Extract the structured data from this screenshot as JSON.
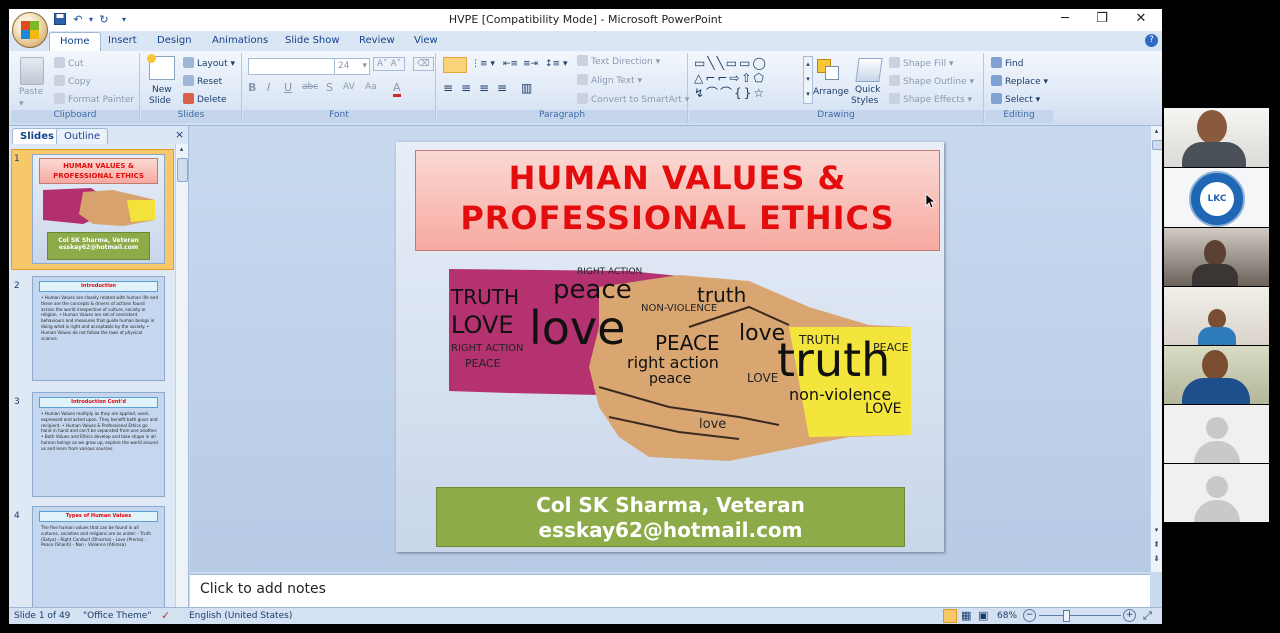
{
  "window": {
    "title": "HVPE [Compatibility Mode] - Microsoft PowerPoint",
    "minimize": "─",
    "restore": "❐",
    "close": "✕"
  },
  "ribbon_tabs": [
    "Home",
    "Insert",
    "Design",
    "Animations",
    "Slide Show",
    "Review",
    "View"
  ],
  "ribbon": {
    "clipboard": {
      "paste": "Paste",
      "cut": "Cut",
      "copy": "Copy",
      "format_painter": "Format Painter",
      "label": "Clipboard"
    },
    "slides": {
      "new_slide_1": "New",
      "new_slide_2": "Slide",
      "layout": "Layout",
      "reset": "Reset",
      "delete": "Delete",
      "label": "Slides"
    },
    "font": {
      "size": "24",
      "label": "Font"
    },
    "paragraph": {
      "text_direction": "Text Direction",
      "align_text": "Align Text",
      "convert": "Convert to SmartArt",
      "label": "Paragraph"
    },
    "drawing": {
      "arrange": "Arrange",
      "quick_styles_1": "Quick",
      "quick_styles_2": "Styles",
      "shape_fill": "Shape Fill",
      "shape_outline": "Shape Outline",
      "shape_effects": "Shape Effects",
      "label": "Drawing"
    },
    "editing": {
      "find": "Find",
      "replace": "Replace",
      "select": "Select",
      "label": "Editing"
    }
  },
  "left_pane": {
    "tabs": [
      "Slides",
      "Outline"
    ],
    "close": "×",
    "thumbs": [
      {
        "num": "1",
        "title_1": "HUMAN VALUES &",
        "title_2": "PROFESSIONAL ETHICS",
        "name": "Col SK Sharma, Veteran",
        "email": "esskay62@hotmail.com"
      },
      {
        "num": "2",
        "title": "Introduction",
        "body": "• Human Values are closely related with human life and these are the concepts & drivers of actions found across the world irrespective of culture, society or religion. • Human Values are set of consistent behaviours and measures that guide human beings in doing what is right and acceptable by the society. • Human Values do not follow the laws of physical science."
      },
      {
        "num": "3",
        "title": "Introduction        Cont'd",
        "body": "• Human Values multiply as they are applied, used, expressed and acted upon. They benefit both giver and recipient. • Human Values & Professional Ethics go hand in hand and can't be separated from one another. • Both Values and Ethics develop and take shape in all human beings as we grow up, explore the world around us and learn from various sources."
      },
      {
        "num": "4",
        "title": "Types of Human Values",
        "body": "The five human values that can be found in all cultures, societies and religions are as under: - Truth (Satya) - Right Conduct (Dharma) - Love (Prema) - Peace (Shanti) - Non - Violence (Ahimsa)"
      }
    ]
  },
  "slide": {
    "title_line1": "HUMAN VALUES &",
    "title_line2": "PROFESSIONAL ETHICS",
    "name": "Col SK Sharma, Veteran",
    "email": "esskay62@hotmail.com",
    "words": [
      "TRUTH",
      "peace",
      "RIGHT ACTION",
      "LOVE",
      "love",
      "NON-VIOLENCE",
      "truth",
      "PEACE",
      "right action",
      "love",
      "peace",
      "truth",
      "TRUTH",
      "PEACE",
      "non-violence",
      "LOVE",
      "LOVE",
      "RIGHT ACTION",
      "PEACE",
      "love"
    ]
  },
  "notes": {
    "placeholder": "Click to add notes"
  },
  "status": {
    "slide": "Slide 1 of 49",
    "theme": "\"Office Theme\"",
    "language": "English (United States)",
    "zoom": "68%"
  },
  "colors": {
    "title_red": "#e30d0d",
    "name_green": "#8dab48",
    "title_fill": "#f6a9a0",
    "ribbon_blue": "#15428b"
  }
}
